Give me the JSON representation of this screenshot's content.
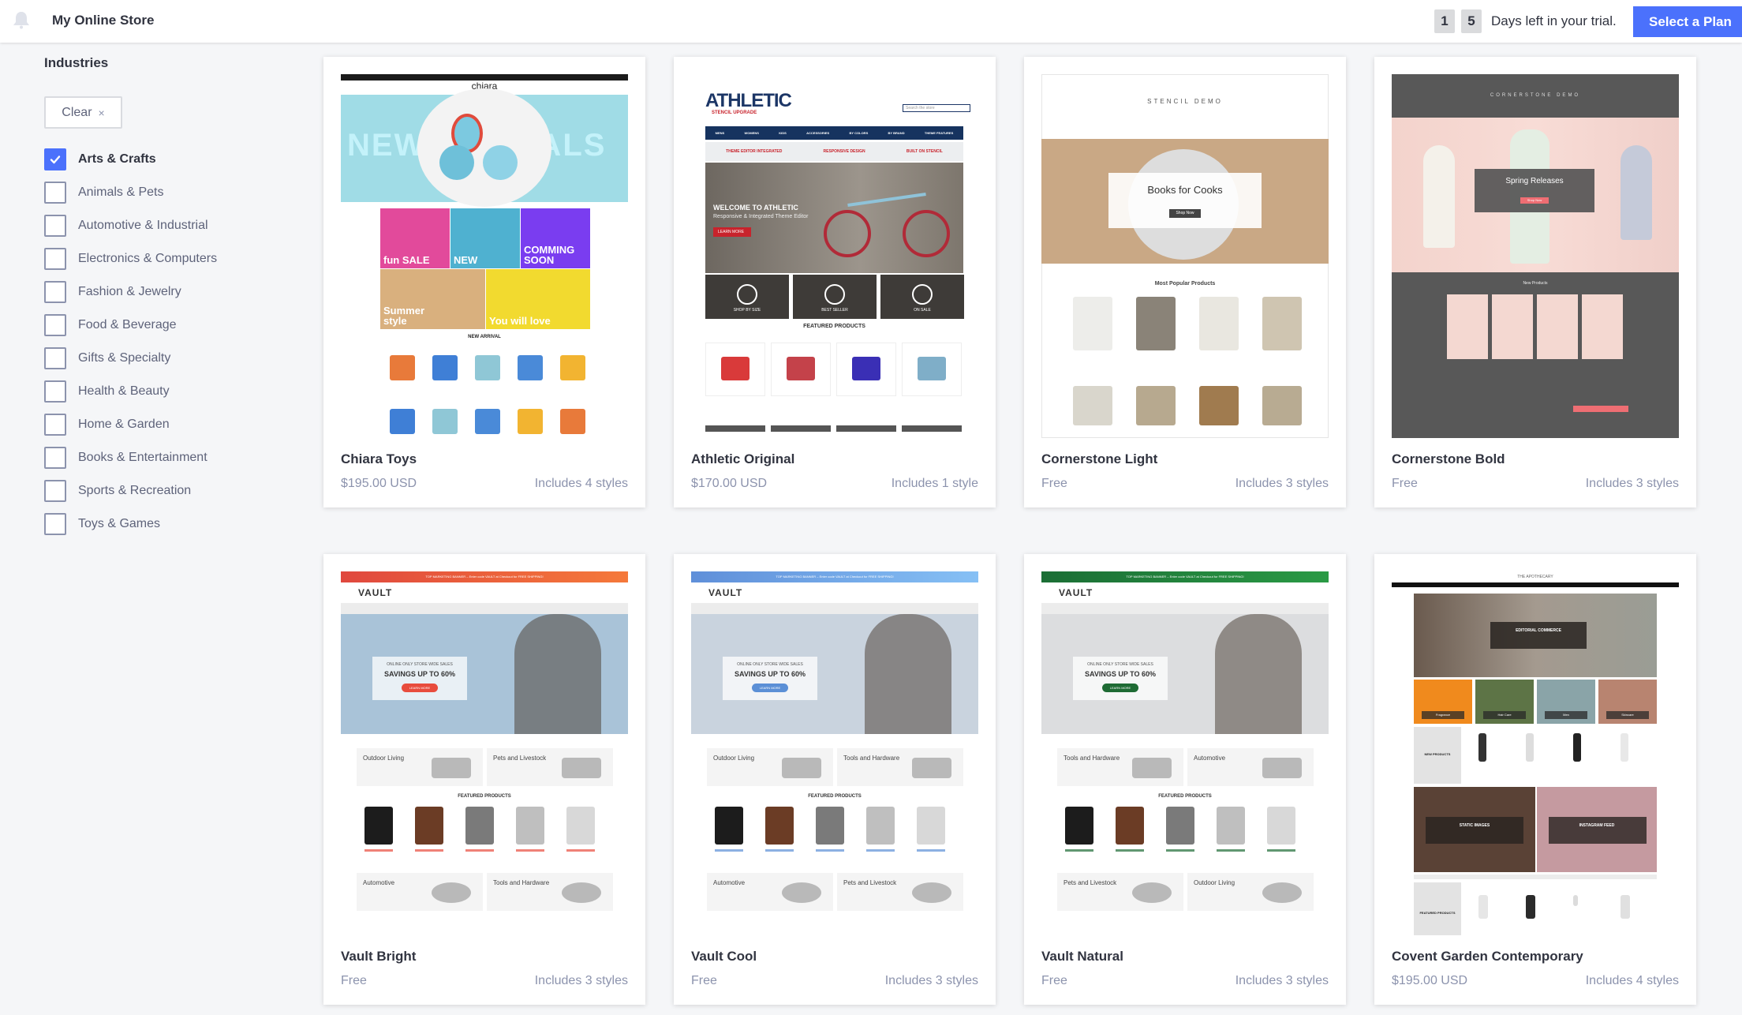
{
  "header": {
    "store_name": "My Online Store",
    "trial_days_digits": [
      "1",
      "5"
    ],
    "trial_text": "Days left in your trial.",
    "select_plan_label": "Select a Plan",
    "bell_icon": "bell-icon"
  },
  "sidebar": {
    "title": "Industries",
    "clear_label": "Clear",
    "clear_icon": "×",
    "filters": [
      {
        "label": "Arts & Crafts",
        "checked": true
      },
      {
        "label": "Animals & Pets",
        "checked": false
      },
      {
        "label": "Automotive & Industrial",
        "checked": false
      },
      {
        "label": "Electronics & Computers",
        "checked": false
      },
      {
        "label": "Fashion & Jewelry",
        "checked": false
      },
      {
        "label": "Food & Beverage",
        "checked": false
      },
      {
        "label": "Gifts & Specialty",
        "checked": false
      },
      {
        "label": "Health & Beauty",
        "checked": false
      },
      {
        "label": "Home & Garden",
        "checked": false
      },
      {
        "label": "Books & Entertainment",
        "checked": false
      },
      {
        "label": "Sports & Recreation",
        "checked": false
      },
      {
        "label": "Toys & Games",
        "checked": false
      }
    ]
  },
  "themes": [
    {
      "name": "Chiara Toys",
      "price": "$195.00 USD",
      "styles": "Includes 4 styles",
      "preview": {
        "logo": "chiara",
        "hero_text": "NEW ARRIVALS",
        "tiles": [
          "fun SALE",
          "NEW",
          "COMMING SOON",
          "Summer style",
          "You will love"
        ],
        "section": "NEW ARRIVAL"
      }
    },
    {
      "name": "Athletic Original",
      "price": "$170.00 USD",
      "styles": "Includes 1 style",
      "preview": {
        "logo": "ATHLETIC",
        "sublogo": "STENCIL UPGRADE",
        "nav": [
          "MENS",
          "WOMENS",
          "KIDS",
          "ACCESSORIES",
          "BY COLORS",
          "BY BRAND",
          "THEME FEATURES"
        ],
        "features": [
          "THEME EDITOR INTEGRATED",
          "RESPONSIVE DESIGN",
          "BUILT ON STENCIL"
        ],
        "hero_title": "WELCOME TO ATHLETIC",
        "hero_sub": "Responsive & Integrated Theme Editor",
        "cta": "LEARN MORE",
        "tiles": [
          "SHOP BY SIZE",
          "BEST SELLER",
          "ON SALE"
        ],
        "section": "FEATURED PRODUCTS",
        "search_placeholder": "Search the store"
      }
    },
    {
      "name": "Cornerstone Light",
      "price": "Free",
      "styles": "Includes 3 styles",
      "preview": {
        "logo": "STENCIL DEMO",
        "hero_title": "Books for Cooks",
        "cta": "Shop Now",
        "section": "Most Popular Products"
      }
    },
    {
      "name": "Cornerstone Bold",
      "price": "Free",
      "styles": "Includes 3 styles",
      "preview": {
        "logo": "CORNERSTONE DEMO",
        "hero_title": "Spring Releases",
        "cta": "Shop Now",
        "section": "New Products"
      }
    },
    {
      "name": "Vault Bright",
      "price": "Free",
      "styles": "Includes 3 styles",
      "preview": {
        "logo": "VAULT",
        "banner": "TOP MARKETING BANNER – Enter code VAULT at Checkout for FREE SHIPPING!",
        "hero_kicker": "ONLINE ONLY STORE WIDE SALES",
        "hero_title": "SAVINGS UP TO 60%",
        "cta": "LEARN MORE",
        "promos": [
          "Outdoor Living",
          "Pets and Livestock",
          "Automotive",
          "Tools and Hardware"
        ],
        "section": "FEATURED PRODUCTS",
        "accent": "#e84c3d",
        "banner_from": "#e0483e",
        "banner_to": "#f5793a",
        "hero_bg": "#a9c3d8"
      }
    },
    {
      "name": "Vault Cool",
      "price": "Free",
      "styles": "Includes 3 styles",
      "preview": {
        "logo": "VAULT",
        "banner": "TOP MARKETING BANNER – Enter code VAULT at Checkout for FREE SHIPPING!",
        "hero_kicker": "ONLINE ONLY STORE WIDE SALES",
        "hero_title": "SAVINGS UP TO 60%",
        "cta": "LEARN MORE",
        "promos": [
          "Outdoor Living",
          "Tools and Hardware",
          "Automotive",
          "Pets and Livestock"
        ],
        "section": "FEATURED PRODUCTS",
        "accent": "#5b8fd6",
        "banner_from": "#5f8fd9",
        "banner_to": "#86c0f5",
        "hero_bg": "#c9d3de"
      }
    },
    {
      "name": "Vault Natural",
      "price": "Free",
      "styles": "Includes 3 styles",
      "preview": {
        "logo": "VAULT",
        "banner": "TOP MARKETING BANNER – Enter code VAULT at Checkout for FREE SHIPPING!",
        "hero_kicker": "ONLINE ONLY STORE WIDE SALES",
        "hero_title": "SAVINGS UP TO 60%",
        "cta": "LEARN MORE",
        "promos": [
          "Tools and Hardware",
          "Automotive",
          "Pets and Livestock",
          "Outdoor Living"
        ],
        "section": "FEATURED PRODUCTS",
        "accent": "#1e6b34",
        "banner_from": "#1b6e35",
        "banner_to": "#2a9a45",
        "hero_bg": "#dcdddf"
      }
    },
    {
      "name": "Covent Garden Contemporary",
      "price": "$195.00 USD",
      "styles": "Includes 4 styles",
      "preview": {
        "logo": "THE APOTHECARY",
        "hero_title": "EDITORIAL COMMERCE",
        "tiles": [
          "Fragrance",
          "Hair Care",
          "Men",
          "Skincare"
        ],
        "section": "NEW PRODUCTS",
        "banners": [
          "STATIC IMAGES",
          "INSTAGRAM FEED"
        ],
        "section2": "FEATURED PRODUCTS"
      }
    }
  ]
}
